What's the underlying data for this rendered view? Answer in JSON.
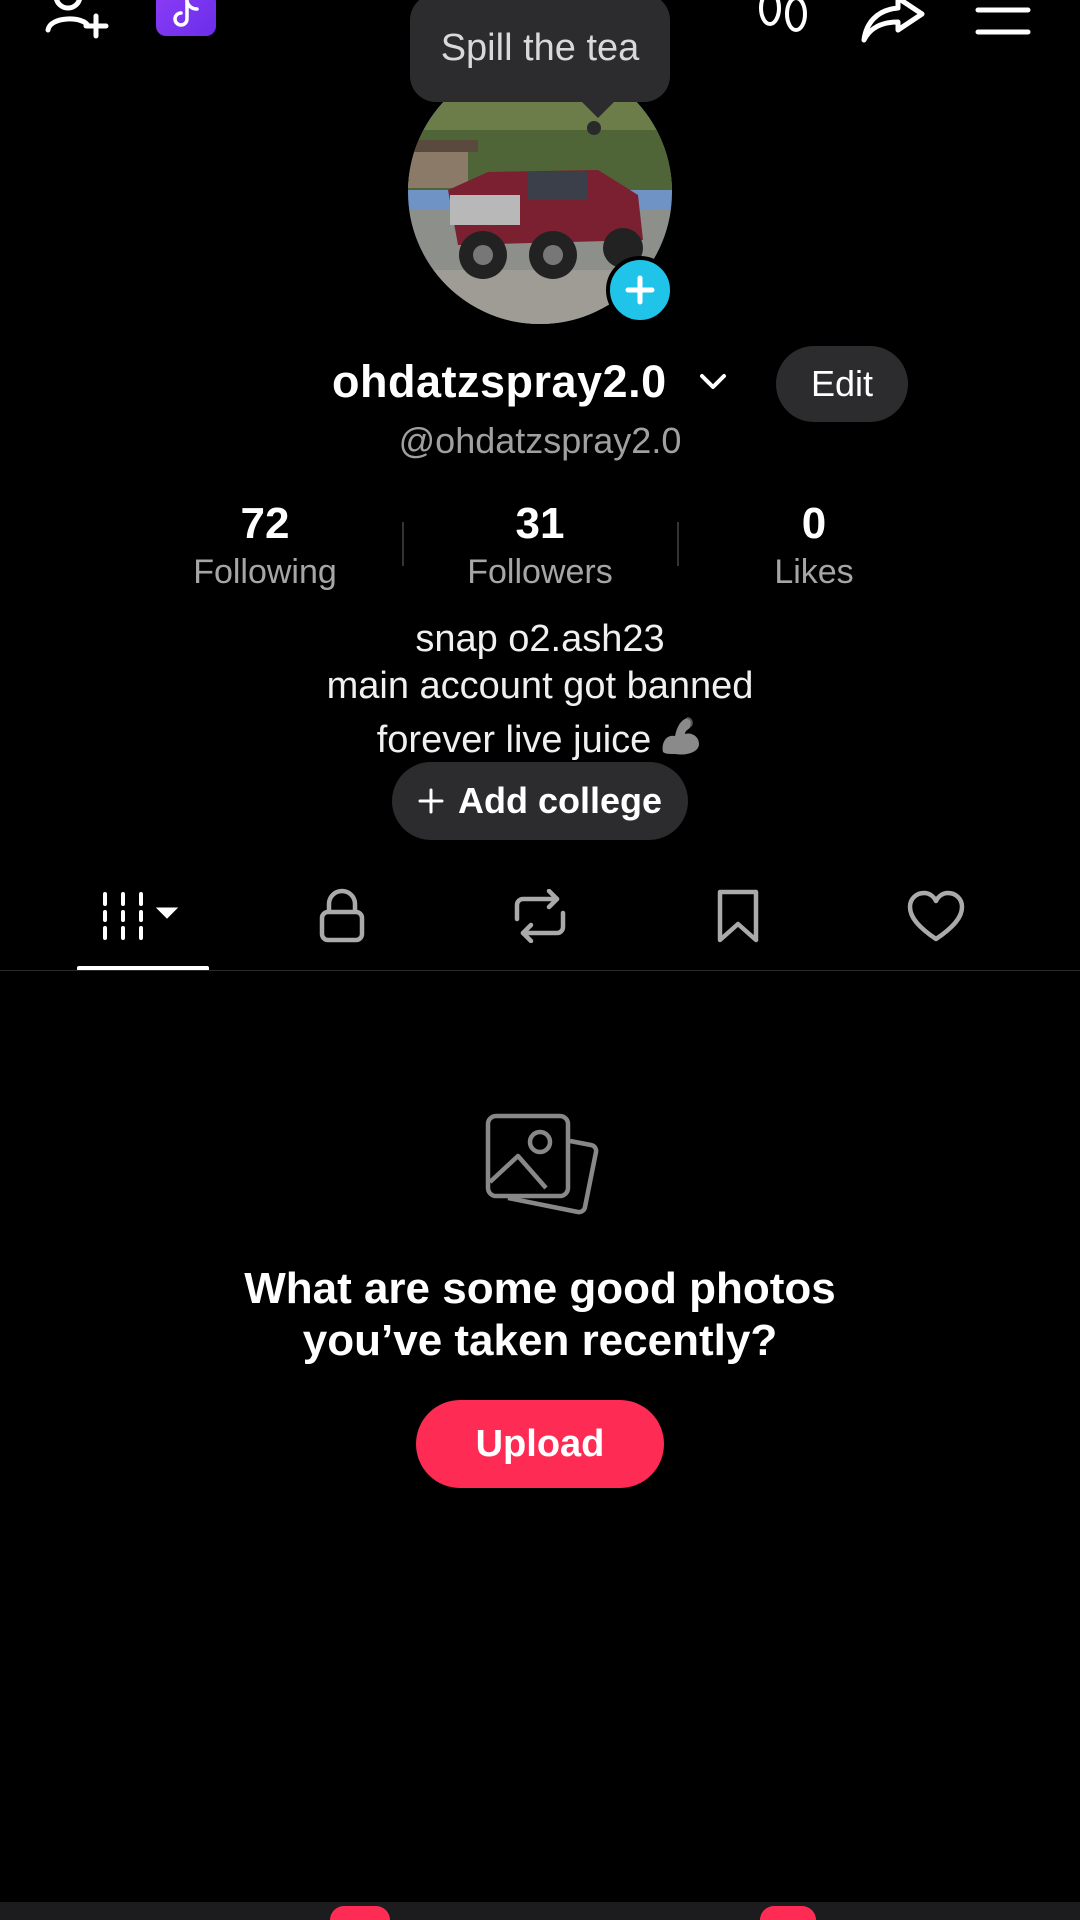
{
  "tooltip": {
    "text": "Spill the tea"
  },
  "profile": {
    "display_name": "ohdatzspray2.0",
    "handle": "@ohdatzspray2.0",
    "edit_label": "Edit"
  },
  "stats": [
    {
      "value": "72",
      "label": "Following"
    },
    {
      "value": "31",
      "label": "Followers"
    },
    {
      "value": "0",
      "label": "Likes"
    }
  ],
  "bio": [
    "snap o2.ash23",
    "main account got banned",
    "forever live juice"
  ],
  "add_college": {
    "label": "Add college"
  },
  "tabs": [
    {
      "icon": "grid-icon",
      "active": true
    },
    {
      "icon": "lock-icon",
      "active": false
    },
    {
      "icon": "repost-icon",
      "active": false
    },
    {
      "icon": "bookmark-icon",
      "active": false
    },
    {
      "icon": "heart-icon",
      "active": false
    }
  ],
  "empty_state": {
    "line1": "What are some good photos",
    "line2": "you’ve taken recently?",
    "upload_label": "Upload"
  },
  "colors": {
    "accent": "#fe2c55",
    "avatar_add": "#20c4e8",
    "surface": "#2c2c2e"
  }
}
